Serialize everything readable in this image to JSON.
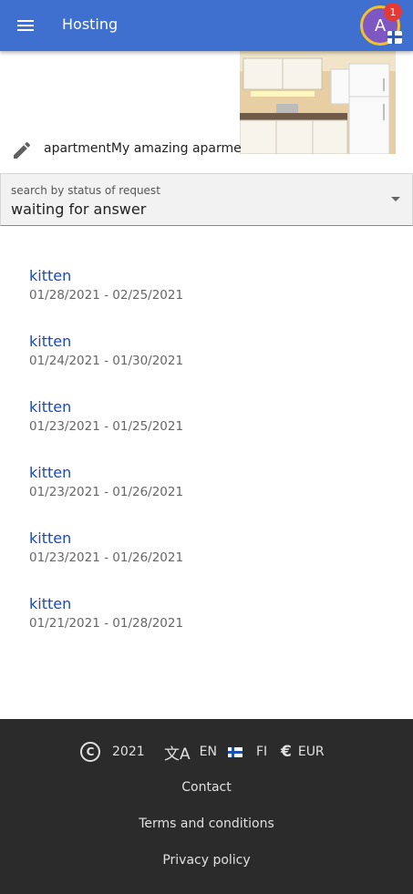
{
  "appbar": {
    "title": "Hosting",
    "menu_icon": "menu-icon",
    "avatar_letter": "A",
    "notification_count": "1",
    "colors": {
      "appbar": "#3f6fcf",
      "avatar": "#7e57c2",
      "avatar_ring": "#f2c12e",
      "badge": "#e53935"
    }
  },
  "property": {
    "image_icon": "kitchen-photo",
    "edit_icon": "pencil-icon",
    "text": "apartmentMy amazing aparment"
  },
  "status_filter": {
    "label": "search by status of request",
    "value": "waiting for answer"
  },
  "requests": [
    {
      "title": "kitten",
      "dates": "01/28/2021 - 02/25/2021"
    },
    {
      "title": "kitten",
      "dates": "01/24/2021 - 01/30/2021"
    },
    {
      "title": "kitten",
      "dates": "01/23/2021 - 01/25/2021"
    },
    {
      "title": "kitten",
      "dates": "01/23/2021 - 01/26/2021"
    },
    {
      "title": "kitten",
      "dates": "01/23/2021 - 01/26/2021"
    },
    {
      "title": "kitten",
      "dates": "01/21/2021 - 01/28/2021"
    }
  ],
  "footer": {
    "year": "2021",
    "language": "EN",
    "country": "FI",
    "currency": "EUR",
    "copyright_symbol": "C",
    "translate_glyph": "文A",
    "euro_glyph": "€",
    "links": {
      "contact": "Contact",
      "terms": "Terms and conditions",
      "privacy": "Privacy policy"
    },
    "colors": {
      "background": "#2b2b2b",
      "link": "#1a47c6"
    }
  }
}
